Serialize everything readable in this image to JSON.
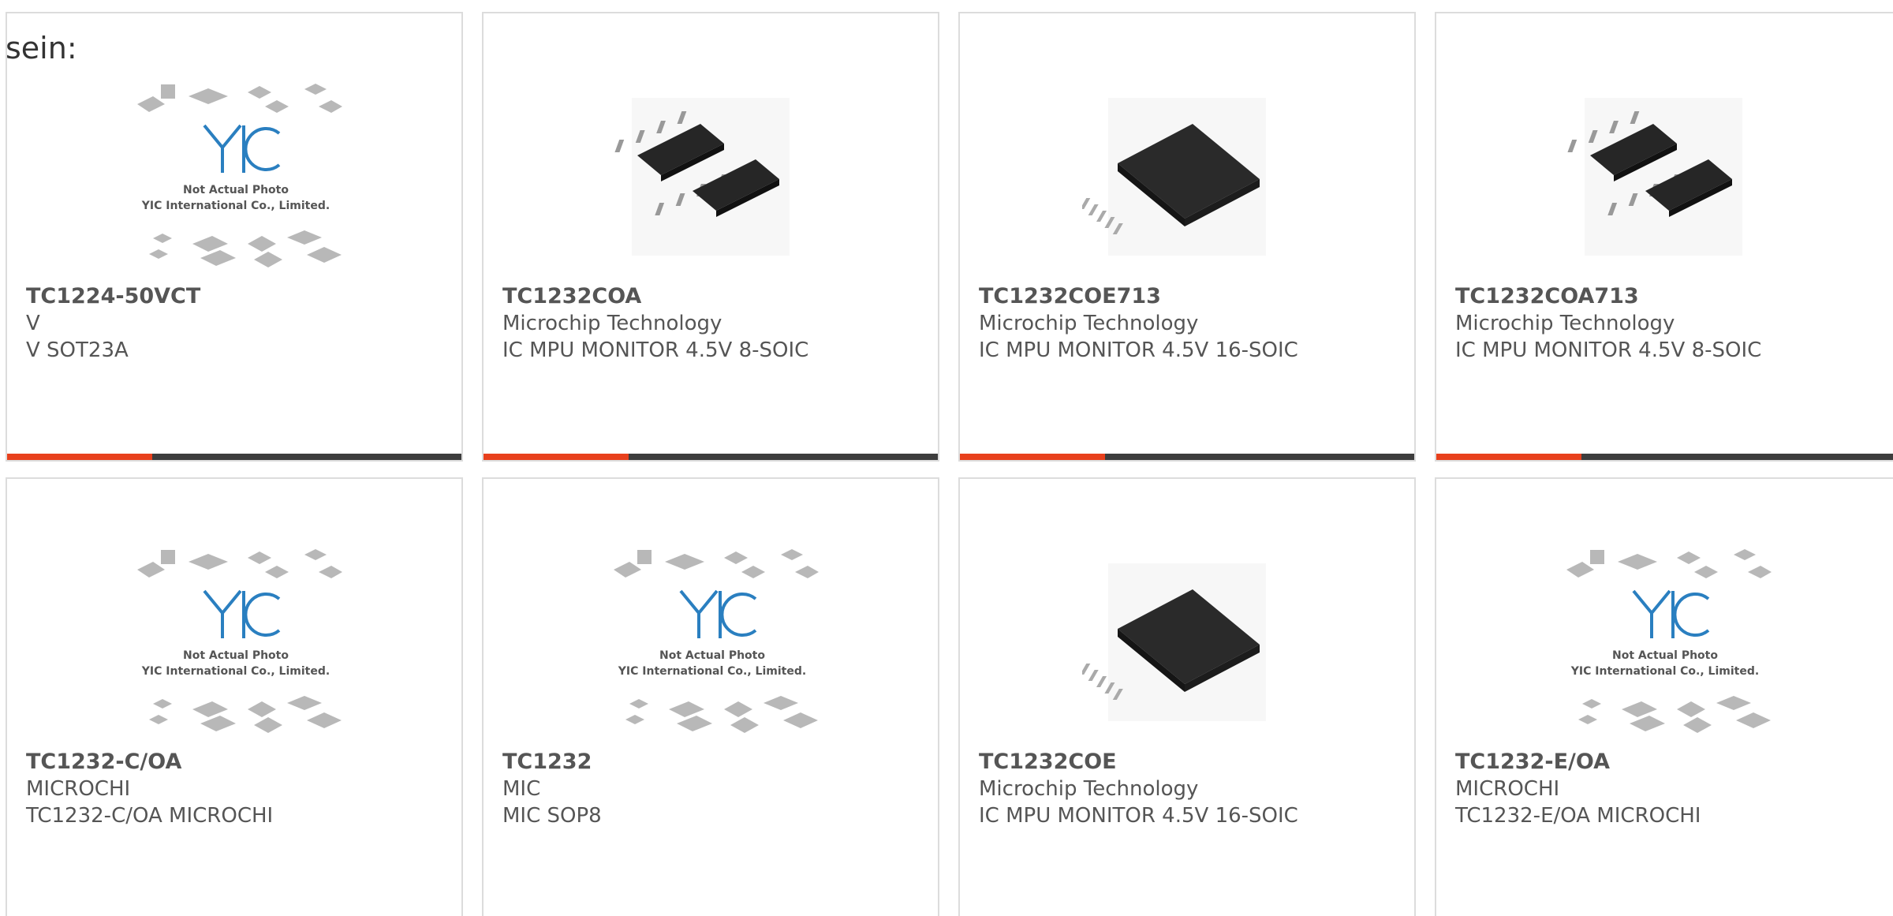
{
  "intro_text": "sein:",
  "colors": {
    "accent": "#e8401c",
    "bar": "#3d3d3d",
    "logo_blue": "#2a7fc0"
  },
  "photo_notice": {
    "line1": "Not Actual Photo",
    "line2": "YIC International Co., Limited."
  },
  "products": [
    {
      "part": "TC1224-50VCT",
      "manufacturer": "V",
      "description": "V SOT23A",
      "image": "placeholder-photo-icon"
    },
    {
      "part": "TC1232COA",
      "manufacturer": "Microchip Technology",
      "description": "IC MPU MONITOR 4.5V 8-SOIC",
      "image": "soic8-chip-icon"
    },
    {
      "part": "TC1232COE713",
      "manufacturer": "Microchip Technology",
      "description": "IC MPU MONITOR 4.5V 16-SOIC",
      "image": "soic16-chip-icon"
    },
    {
      "part": "TC1232COA713",
      "manufacturer": "Microchip Technology",
      "description": "IC MPU MONITOR 4.5V 8-SOIC",
      "image": "soic8-chip-icon"
    },
    {
      "part": "TC1232-C/OA",
      "manufacturer": "MICROCHI",
      "description": "TC1232-C/OA MICROCHI",
      "image": "placeholder-photo-icon"
    },
    {
      "part": "TC1232",
      "manufacturer": "MIC",
      "description": "MIC SOP8",
      "image": "placeholder-photo-icon"
    },
    {
      "part": "TC1232COE",
      "manufacturer": "Microchip Technology",
      "description": "IC MPU MONITOR 4.5V 16-SOIC",
      "image": "soic16-chip-icon"
    },
    {
      "part": "TC1232-E/OA",
      "manufacturer": "MICROCHI",
      "description": "TC1232-E/OA MICROCHI",
      "image": "placeholder-photo-icon"
    }
  ]
}
